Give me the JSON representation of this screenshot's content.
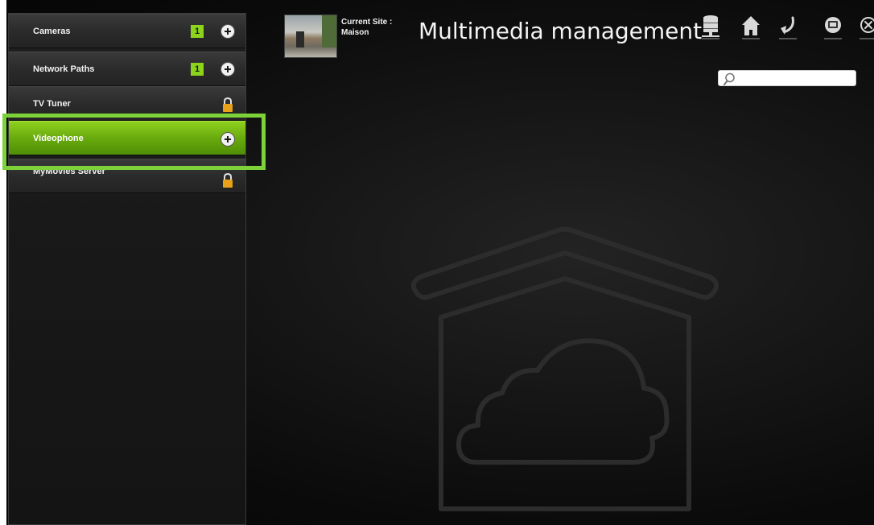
{
  "sidebar": {
    "items": [
      {
        "label": "Cameras",
        "count": "1",
        "action": "add"
      },
      {
        "label": "Network Paths",
        "count": "1",
        "action": "add"
      },
      {
        "label": "TV Tuner",
        "action": "locked"
      },
      {
        "label": "Videophone",
        "action": "add",
        "active": true
      },
      {
        "label": "MyMovies Server",
        "action": "locked"
      }
    ]
  },
  "header": {
    "site_label": "Current Site :",
    "site_name": "Maison",
    "title": "Multimedia management"
  },
  "toolbar": {
    "icons": [
      "database-icon",
      "home-icon",
      "back-arrow-icon",
      "display-icon",
      "close-icon"
    ]
  },
  "search": {
    "value": "",
    "placeholder": ""
  },
  "colors": {
    "accent": "#7dd23a",
    "active_item": "#6cae0f",
    "badge": "#8cd31c",
    "lock": "#e8a21a",
    "background": "#111111"
  }
}
